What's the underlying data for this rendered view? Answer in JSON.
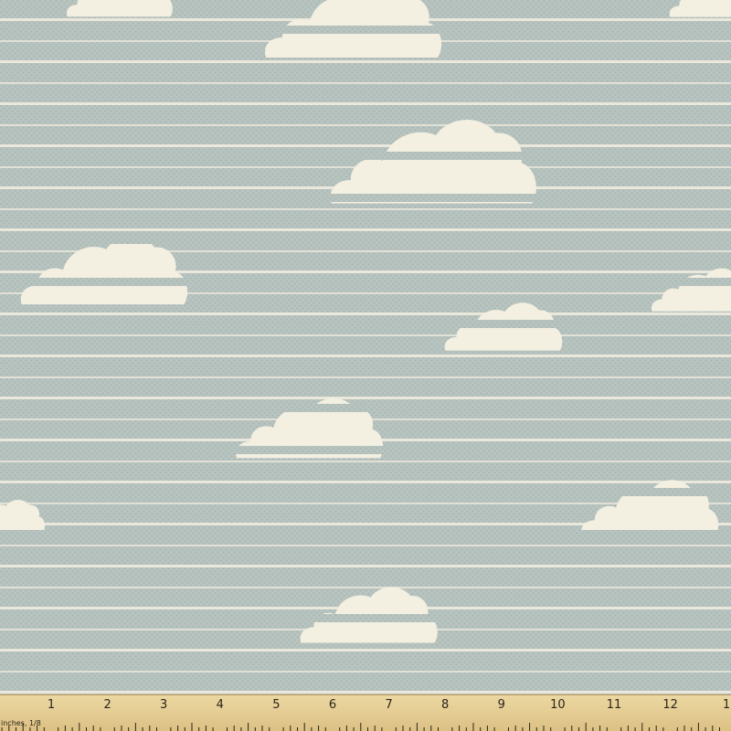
{
  "colors": {
    "background": "#b8c4c0",
    "cloud": "#f3efe1",
    "stripe": "#f3efe1",
    "weave": "#a9b6b2",
    "ruler": "#e6cf97",
    "ruler_ink": "#2b2418"
  },
  "ruler": {
    "unit_label": "inches, 1/8",
    "numbers": [
      "1",
      "2",
      "3",
      "4",
      "5",
      "6",
      "7",
      "8",
      "9",
      "10",
      "11",
      "12",
      "1"
    ]
  }
}
